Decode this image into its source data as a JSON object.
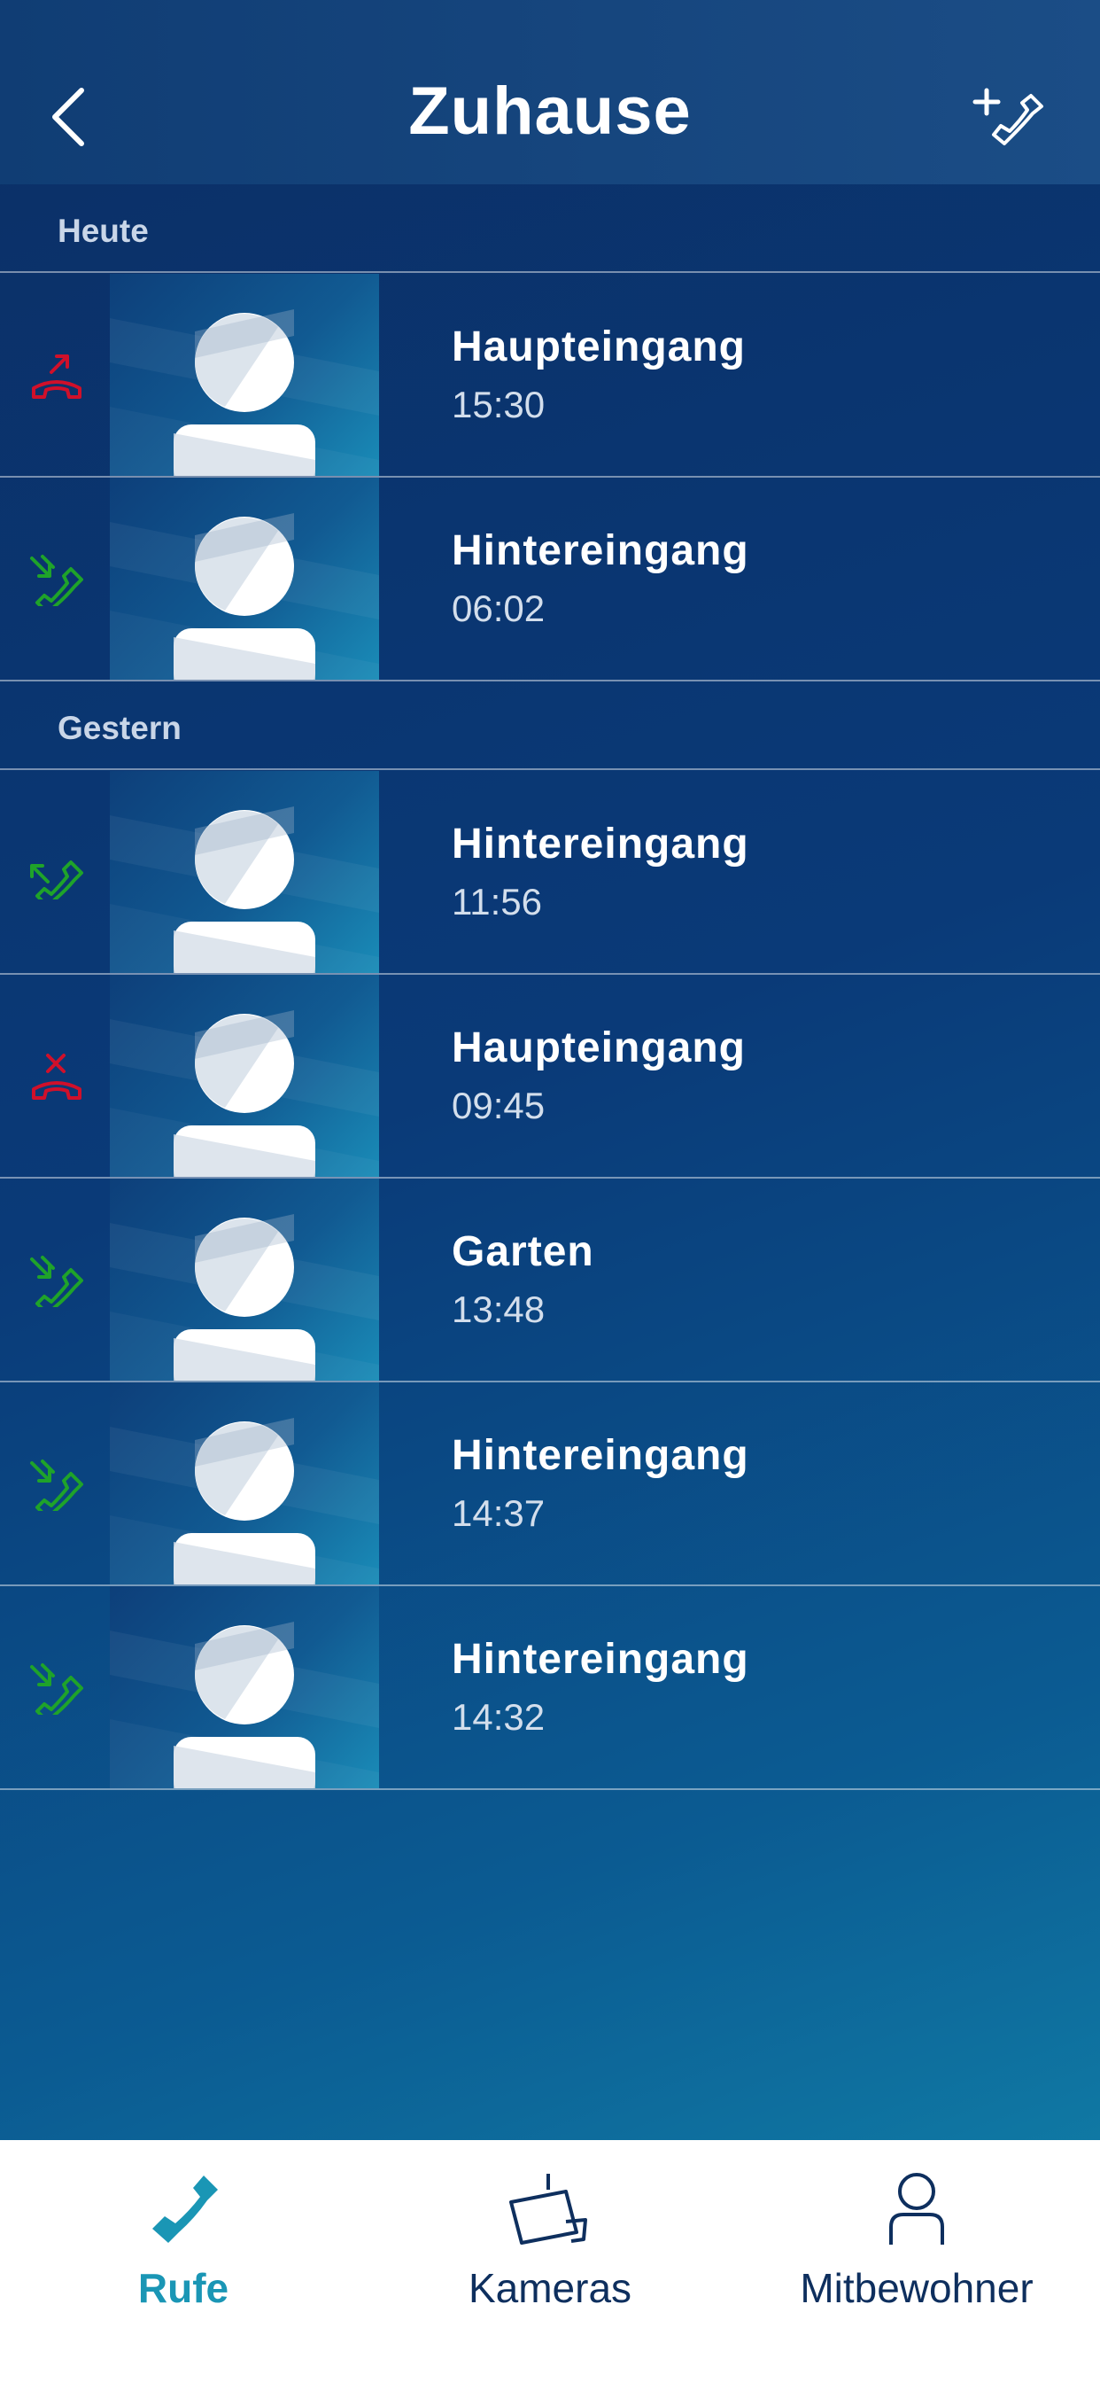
{
  "header": {
    "title": "Zuhause",
    "back_icon": "chevron-left-icon",
    "add_icon": "add-call-icon"
  },
  "sections": [
    {
      "label": "Heute",
      "calls": [
        {
          "name": "Haupteingang",
          "time": "15:30",
          "status": "outgoing-rejected",
          "color": "#d0102a"
        },
        {
          "name": "Hintereingang",
          "time": "06:02",
          "status": "incoming",
          "color": "#1fa32a"
        }
      ]
    },
    {
      "label": "Gestern",
      "calls": [
        {
          "name": "Hintereingang",
          "time": "11:56",
          "status": "outgoing",
          "color": "#1fa32a"
        },
        {
          "name": "Haupteingang",
          "time": "09:45",
          "status": "missed",
          "color": "#d0102a"
        },
        {
          "name": "Garten",
          "time": "13:48",
          "status": "incoming",
          "color": "#1fa32a"
        },
        {
          "name": "Hintereingang",
          "time": "14:37",
          "status": "incoming",
          "color": "#1fa32a"
        },
        {
          "name": "Hintereingang",
          "time": "14:32",
          "status": "incoming",
          "color": "#1fa32a"
        }
      ]
    }
  ],
  "tabs": [
    {
      "label": "Rufe",
      "icon": "phone-icon",
      "active": true
    },
    {
      "label": "Kameras",
      "icon": "camera-icon",
      "active": false
    },
    {
      "label": "Mitbewohner",
      "icon": "person-icon",
      "active": false
    }
  ],
  "colors": {
    "accent": "#1a96b5",
    "header_bg": "#143f76",
    "tab_text": "#0e2f5e"
  }
}
